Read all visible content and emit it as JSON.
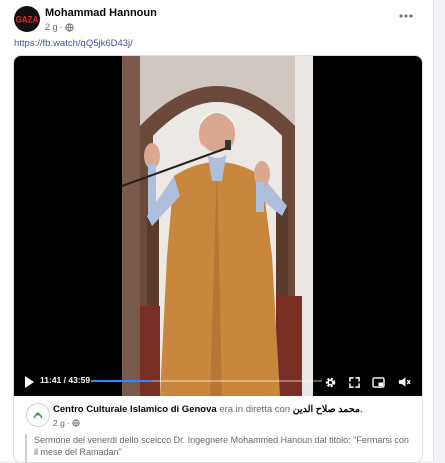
{
  "post": {
    "author": "Mohammad Hannoun",
    "time": "2 g",
    "separator": "·",
    "avatar_text": "GAZA",
    "link": "https://fb.watch/qQ5jk6D43j/"
  },
  "video": {
    "time_display": "11:41 / 43:59",
    "progress": 0.266
  },
  "shared": {
    "page_name": "Centro Culturale Islamico di Genova",
    "live_text": "era in diretta con",
    "with_name": "محمد صلاح الدين",
    "period": ".",
    "time": "2 g",
    "separator": "·",
    "description": "Sermone del venerdi dello sceicco Dr. Ingegnere Mohammed Hanoun dal titolo: \"Fermarsi con il mese del Ramadan\""
  },
  "icons": {
    "more": "more-options-icon",
    "globe": "globe-icon",
    "play": "play-icon",
    "settings": "gear-icon",
    "expand": "expand-icon",
    "pip": "picture-in-picture-icon",
    "volume": "mute-icon"
  },
  "colors": {
    "link": "#385898",
    "progress": "#2d88ff",
    "robe": "#c9873e"
  }
}
